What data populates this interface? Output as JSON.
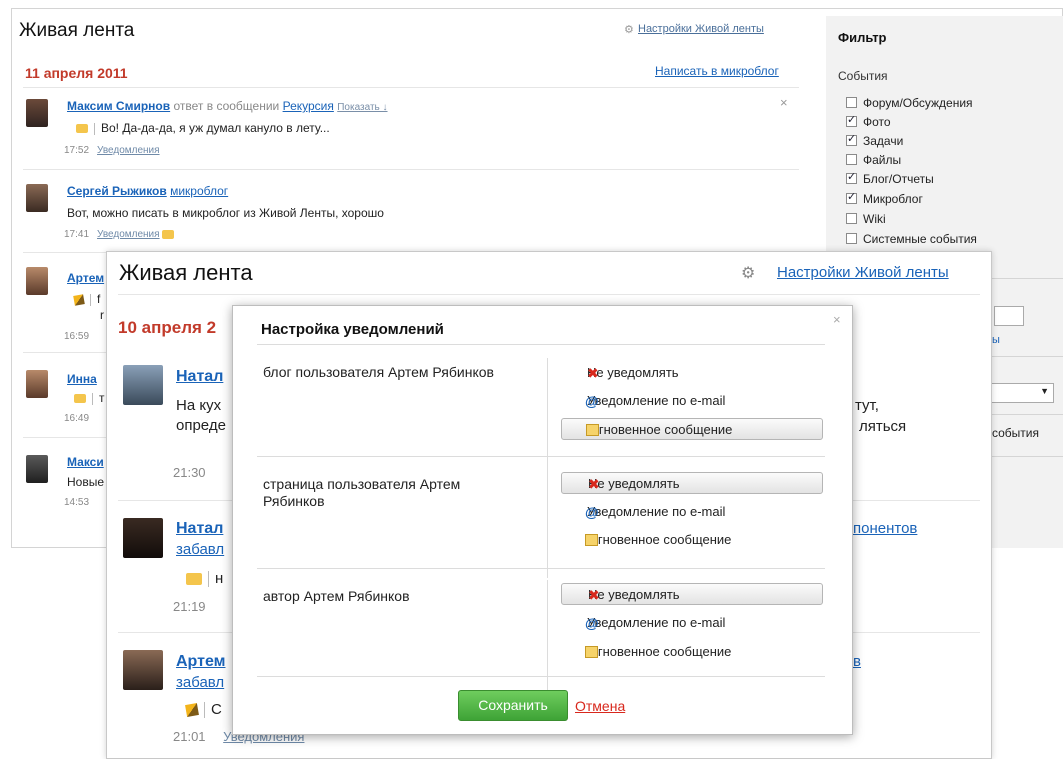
{
  "back_window": {
    "title": "Живая лента",
    "settings_link": "Настройки Живой ленты",
    "date": "11 апреля 2011",
    "write_blog": "Написать в микроблог",
    "close": "×",
    "entries": [
      {
        "name": "Максим Смирнов",
        "action": "ответ в сообщении",
        "target": "Рекурсия",
        "show": "Показать ↓",
        "text": "Во! Да-да-да, я уж думал кануло в лету...",
        "time": "17:52",
        "notify": "Уведомления"
      },
      {
        "name": "Сергей Рыжиков",
        "action": "микроблог",
        "text": "Вот, можно писать в микроблог из Живой Ленты, хорошо",
        "time": "17:41",
        "notify": "Уведомления"
      },
      {
        "name": "Артем",
        "text_a": "f",
        "text_b": "r",
        "time": "16:59"
      },
      {
        "name": "Инна",
        "text": "т",
        "time": "16:49"
      },
      {
        "name": "Макси",
        "text": "Новые",
        "time": "14:53"
      }
    ]
  },
  "filter": {
    "title": "Фильтр",
    "section": "События",
    "items": [
      {
        "label": "Форум/Обсуждения",
        "checked": false
      },
      {
        "label": "Фото",
        "checked": true
      },
      {
        "label": "Задачи",
        "checked": true
      },
      {
        "label": "Файлы",
        "checked": false
      },
      {
        "label": "Блог/Отчеты",
        "checked": true
      },
      {
        "label": "Микроблог",
        "checked": true
      },
      {
        "label": "Wiki",
        "checked": false
      },
      {
        "label": "Системные события",
        "checked": false
      }
    ],
    "link_fragment": "ы",
    "select_arrow": "▼",
    "events_label": "события"
  },
  "middle_window": {
    "title": "Живая лента",
    "settings_link": "Настройки Живой ленты",
    "date": "10 апреля 2",
    "entries": [
      {
        "name": "Натал",
        "line1": "На кух",
        "line2": "опреде",
        "right1": "тут,",
        "right2": "ляться",
        "time": "21:30"
      },
      {
        "name": "Натал",
        "sub": "забавл",
        "right_link": "понентов",
        "text": "н",
        "time": "21:19"
      },
      {
        "name": "Артем",
        "sub": "забавл",
        "right_link": "в",
        "text": "С",
        "time": "21:01",
        "notify": "Уведомления"
      }
    ]
  },
  "modal": {
    "title": "Настройка уведомлений",
    "close": "×",
    "groups": [
      {
        "label": "блог пользователя Артем Рябинков",
        "options": [
          "Не уведомлять",
          "Уведомление по e-mail",
          "Мгновенное сообщение"
        ],
        "selected": 2
      },
      {
        "label": "страница пользователя Артем Рябинков",
        "options": [
          "Не уведомлять",
          "Уведомление по e-mail",
          "Мгновенное сообщение"
        ],
        "selected": 0
      },
      {
        "label": "автор Артем Рябинков",
        "options": [
          "Не уведомлять",
          "Уведомление по e-mail",
          "Мгновенное сообщение"
        ],
        "selected": 0
      }
    ],
    "save": "Сохранить",
    "cancel": "Отмена"
  }
}
